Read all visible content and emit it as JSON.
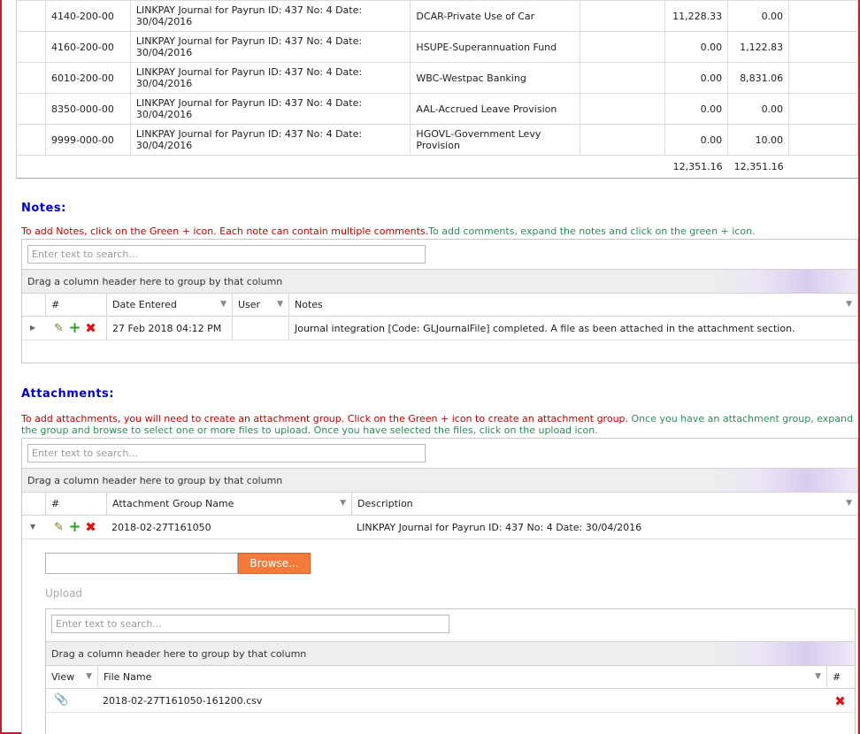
{
  "journal": {
    "rows": [
      {
        "account": "4140-200-00",
        "description": "LINKPAY Journal for Payrun ID: 437 No: 4 Date: 30/04/2016",
        "account_name": "DCAR-Private Use of Car",
        "debit": "11,228.33",
        "credit": "0.00"
      },
      {
        "account": "4160-200-00",
        "description": "LINKPAY Journal for Payrun ID: 437 No: 4 Date: 30/04/2016",
        "account_name": "HSUPE-Superannuation Fund",
        "debit": "0.00",
        "credit": "1,122.83"
      },
      {
        "account": "6010-200-00",
        "description": "LINKPAY Journal for Payrun ID: 437 No: 4 Date: 30/04/2016",
        "account_name": "WBC-Westpac Banking",
        "debit": "0.00",
        "credit": "8,831.06"
      },
      {
        "account": "8350-000-00",
        "description": "LINKPAY Journal for Payrun ID: 437 No: 4 Date: 30/04/2016",
        "account_name": "AAL-Accrued Leave Provision",
        "debit": "0.00",
        "credit": "0.00"
      },
      {
        "account": "9999-000-00",
        "description": "LINKPAY Journal for Payrun ID: 437 No: 4 Date: 30/04/2016",
        "account_name": "HGOVL-Government Levy Provision",
        "debit": "0.00",
        "credit": "10.00"
      }
    ],
    "total_debit": "12,351.16",
    "total_credit": "12,351.16"
  },
  "notes": {
    "title": "Notes:",
    "instruction_red": "To add Notes, click on the Green + icon. Each note can contain multiple comments.",
    "instruction_green": "To add comments, expand the notes and click on the green + icon.",
    "search_placeholder": "Enter text to search...",
    "group_hint": "Drag a column header here to group by that column",
    "columns": {
      "num": "#",
      "date": "Date Entered",
      "user": "User",
      "notes": "Notes"
    },
    "rows": [
      {
        "date": "27 Feb 2018 04:12 PM",
        "user": "",
        "notes": "Journal integration [Code: GLJournalFile] completed. A file as been attached in the attachment section."
      }
    ]
  },
  "attachments": {
    "title": "Attachments:",
    "instruction_red": "To add attachments, you will need to create an attachment group. Click on the Green + icon to create an attachment group.",
    "instruction_green": " Once you have an attachment group, expand the group and browse to select one or more files to upload. Once you have selected the files, click on the upload icon.",
    "search_placeholder": "Enter text to search...",
    "group_hint": "Drag a column header here to group by that column",
    "columns": {
      "num": "#",
      "group_name": "Attachment Group Name",
      "description": "Description"
    },
    "rows": [
      {
        "group_name": "2018-02-27T161050",
        "description": "LINKPAY Journal for Payrun ID: 437 No: 4 Date: 30/04/2016"
      }
    ],
    "browse_label": "Browse...",
    "upload_label": "Upload",
    "files": {
      "search_placeholder": "Enter text to search...",
      "group_hint": "Drag a column header here to group by that column",
      "columns": {
        "view": "View",
        "file_name": "File Name",
        "num": "#"
      },
      "rows": [
        {
          "file_name": "2018-02-27T161050-161200.csv"
        }
      ]
    }
  }
}
